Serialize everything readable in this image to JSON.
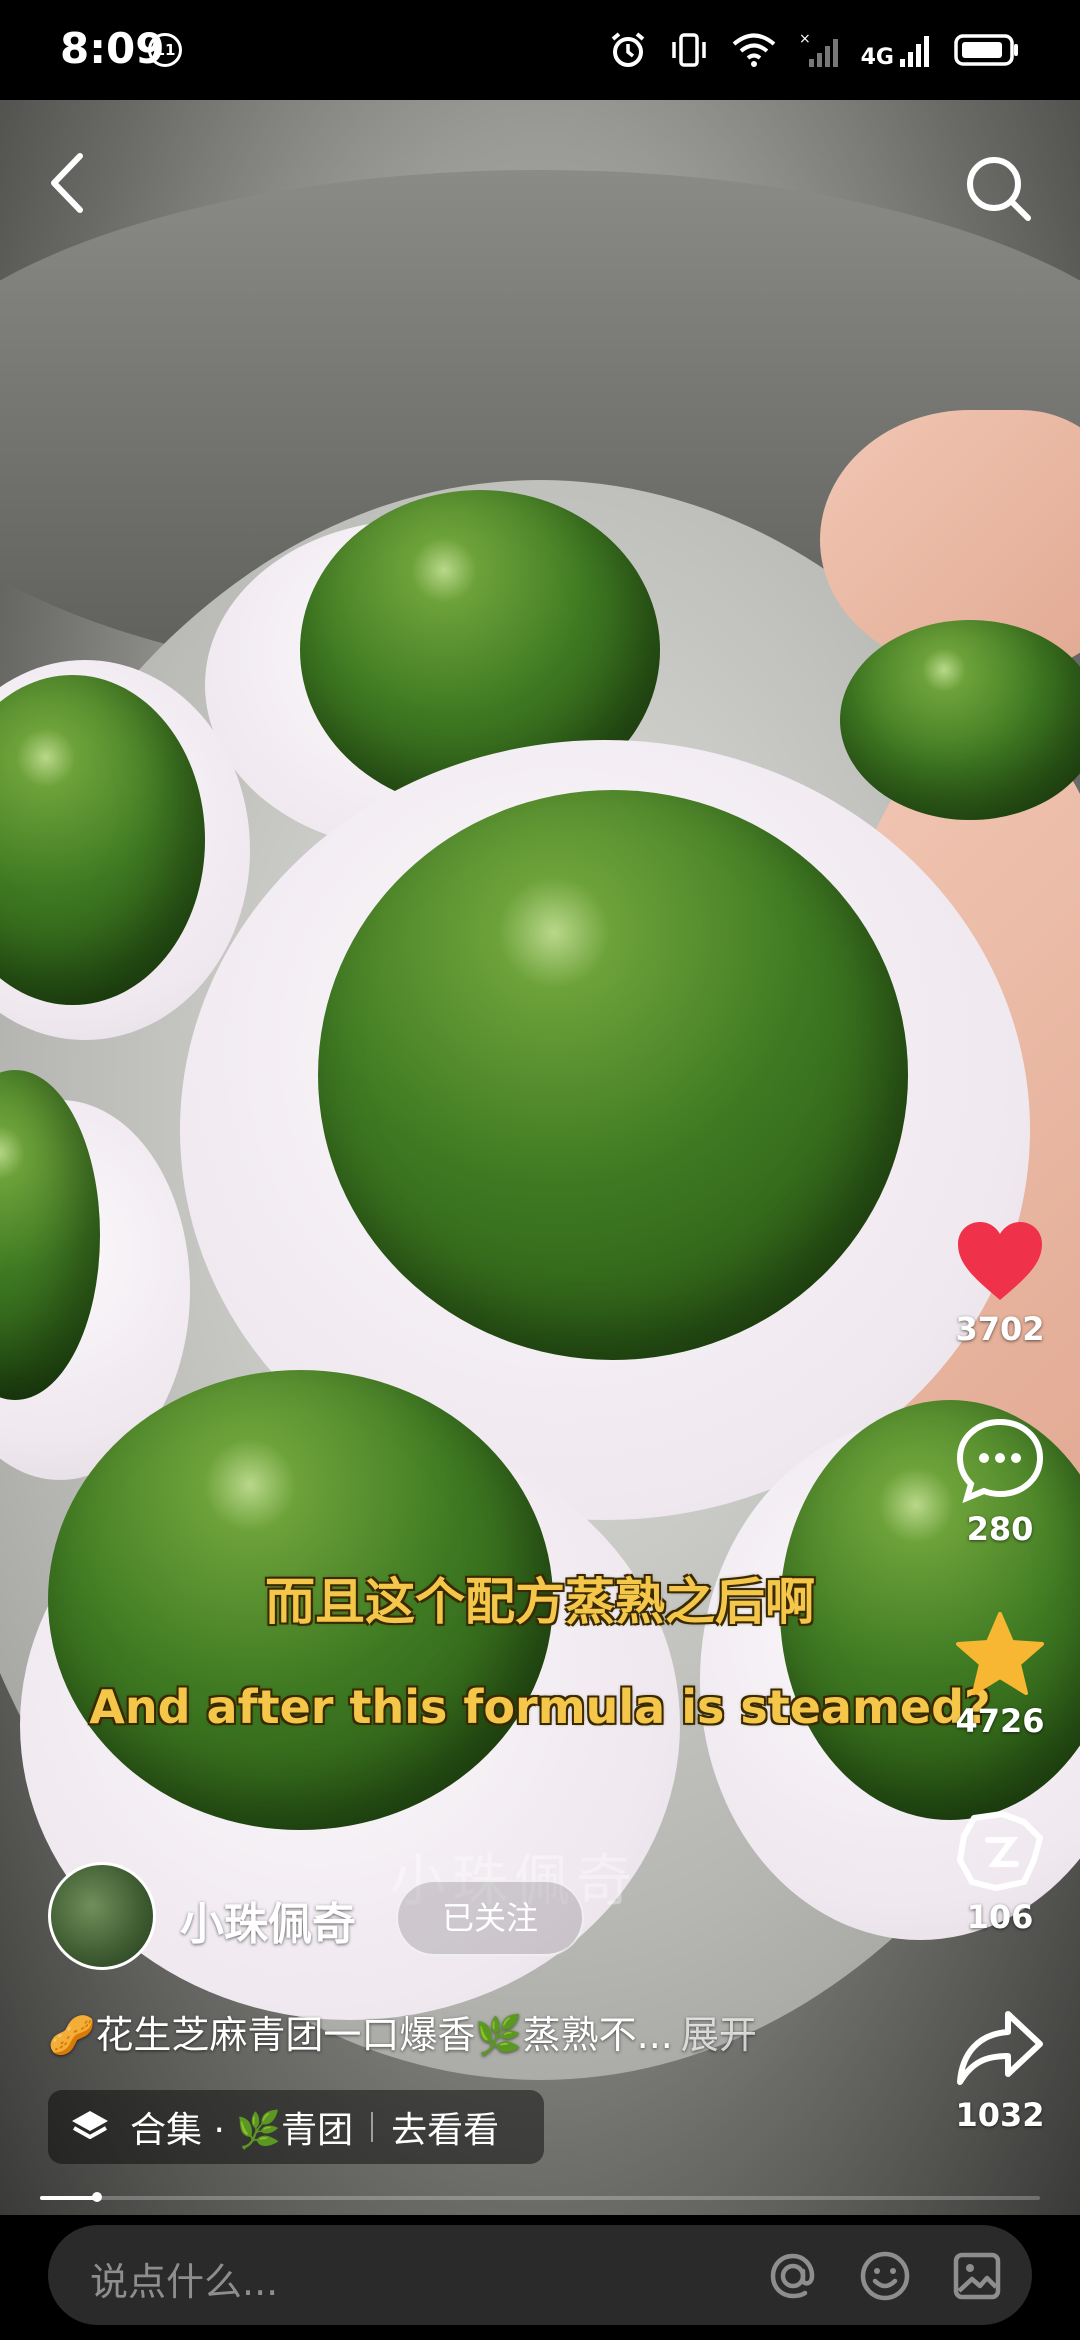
{
  "status_bar": {
    "time": "8:09",
    "badge": "11",
    "network": "4G"
  },
  "subtitles": {
    "chinese": "而且这个配方蒸熟之后啊",
    "english": "And after this formula is steamed?"
  },
  "watermark": "小珠佩奇",
  "actions": {
    "likes": "3702",
    "comments": "280",
    "favorites": "4726",
    "remix": "106",
    "shares": "1032"
  },
  "author": {
    "name": "小珠佩奇",
    "follow_status": "已关注"
  },
  "description": {
    "text": "🥜花生芝麻青团一口爆香🌿蒸熟不...",
    "more": "展开"
  },
  "collection": {
    "label": "合集 · 🌿青团",
    "action": "去看看"
  },
  "progress": {
    "fraction": 0.057
  },
  "comment_box": {
    "placeholder": "说点什么..."
  },
  "colors": {
    "like": "#f0314a",
    "favorite": "#f7b733",
    "subtitle": "#f4c74a"
  },
  "icons": [
    "back-icon",
    "search-icon",
    "heart-icon",
    "comment-icon",
    "star-icon",
    "remix-icon",
    "share-icon",
    "layers-icon",
    "at-icon",
    "emoji-icon",
    "image-icon"
  ]
}
